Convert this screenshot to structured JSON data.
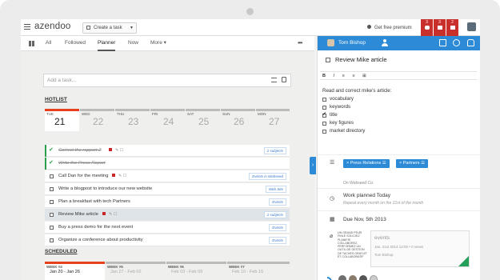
{
  "app": {
    "logo": "azendoo",
    "create_task_label": "Create a task",
    "premium_label": "Get free premium",
    "notifications": [
      {
        "count": "3",
        "icon": "chat-icon"
      },
      {
        "count": "3",
        "icon": "grid-icon"
      },
      {
        "count": "2",
        "icon": "list-icon"
      }
    ]
  },
  "tabs": [
    "All",
    "Followed",
    "Planner",
    "Now",
    "More ▾"
  ],
  "add_task_placeholder": "Add a task...",
  "hotlist": {
    "title": "HOTLIST",
    "days": [
      {
        "label": "TUE",
        "num": "21"
      },
      {
        "label": "WED",
        "num": "22"
      },
      {
        "label": "THU",
        "num": "23"
      },
      {
        "label": "FRI",
        "num": "24"
      },
      {
        "label": "SAT",
        "num": "25"
      },
      {
        "label": "SUN",
        "num": "26"
      },
      {
        "label": "MON",
        "num": "27"
      }
    ]
  },
  "tasks": [
    {
      "text": "Correct the rapport 2",
      "done": true,
      "tag": "2 subjects"
    },
    {
      "text": "Write the Press Report",
      "done": true,
      "tag": ""
    },
    {
      "text": "Call Dan for the meeting",
      "done": false,
      "tag": "Events in Webseed"
    },
    {
      "text": "Write a blogpost to introduce our new website",
      "done": false,
      "tag": "Web Site"
    },
    {
      "text": "Plan a breakfast with tech Partners",
      "done": false,
      "tag": "Events"
    },
    {
      "text": "Review Mike article",
      "done": false,
      "tag": "2 subjects"
    },
    {
      "text": "Buy a press demo for the next event",
      "done": false,
      "tag": "Events"
    },
    {
      "text": "Organize a conference about productivity",
      "done": false,
      "tag": "Events"
    }
  ],
  "scheduled": {
    "title": "SCHEDULED",
    "weeks": [
      {
        "label": "WEEK #4",
        "range": "Jan 20 - Jan 26"
      },
      {
        "label": "WEEK #5",
        "range": "Jan 27 - Feb 02"
      },
      {
        "label": "WEEK #6",
        "range": "Feb 03 - Feb 09"
      },
      {
        "label": "WEEK #7",
        "range": "Feb 10 - Feb 16"
      }
    ]
  },
  "detail": {
    "user_name": "Tom Bishop",
    "task_title": "Review Mike article",
    "toolbar": [
      "B",
      "I",
      "≡",
      "≡",
      "⊞"
    ],
    "desc_intro": "Read and correct mike's article:",
    "checklist": [
      {
        "text": "vocabulary",
        "checked": false
      },
      {
        "text": "keywords",
        "checked": false
      },
      {
        "text": "title",
        "checked": true
      },
      {
        "text": "key figures",
        "checked": false
      },
      {
        "text": "market directory",
        "checked": false
      }
    ],
    "subjects": [
      "Press Relations",
      "Partners"
    ],
    "org": "On Webseed Co.",
    "workplan_title": "Work planned Today",
    "workplan_sub": "Repeat every month on the 21st of the month",
    "due": "Due Nov, 5th 2013",
    "attachment": {
      "title": "events",
      "meta": "Jan, 21st 2014 12:00 • 0 views",
      "author": "Tom Bishop",
      "thumb_text": "UN GRAND PEUR FINLE SOLICIEZ PLANIFIE COLLABOREZ, PERFORMEZ UN OUTIL DE GESTION DE TACHES GRATUIT ET COLLABORATIF"
    }
  },
  "colors": {
    "accent": "#2d8ad6",
    "today": "#e8401c",
    "notif": "#c9302c",
    "done": "#2aa04a"
  }
}
